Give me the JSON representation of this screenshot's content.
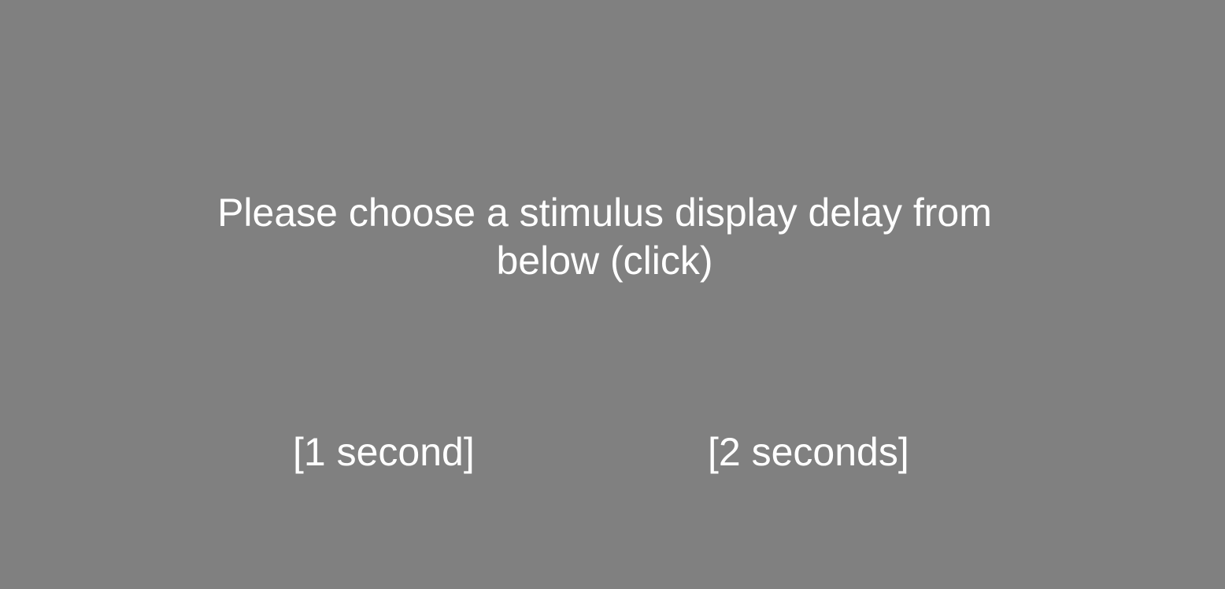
{
  "colors": {
    "background": "#808080",
    "text": "#ffffff"
  },
  "prompt": {
    "text": "Please choose a stimulus display delay from below (click)"
  },
  "options": [
    {
      "label": "[1 second]"
    },
    {
      "label": "[2 seconds]"
    }
  ]
}
